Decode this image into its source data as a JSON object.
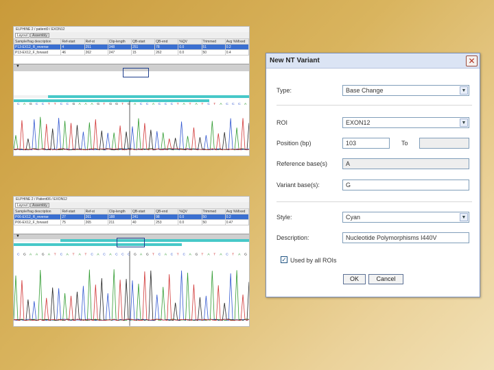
{
  "panels": {
    "top": {
      "title": "ELPHINE 2 / patient0 / EXON12",
      "tabs": [
        "Layout",
        "Assembly"
      ],
      "headers": [
        "Sample/frag description",
        "Ref-start",
        "Ref-st",
        "Clip-length",
        "QB-start",
        "QB-end",
        "%QV",
        "Trimmed",
        "Avg %Mixed",
        "Avg"
      ],
      "rows": [
        [
          "P13-EX12_R_reverse",
          "4",
          "251",
          "348",
          "251",
          "78",
          "0.0",
          "51",
          "0.2"
        ],
        [
          "P13-EX12_F_forward",
          "46",
          "262",
          "247",
          "15",
          "262",
          "0.0",
          "50",
          "0.4"
        ]
      ]
    },
    "bottom": {
      "title": "ELPHINE 2 / Patient06 / EXON12",
      "tabs": [
        "Layout",
        "Assembly"
      ],
      "headers": [
        "Sample/frag description",
        "Ref-start",
        "Ref-st",
        "Clip-length",
        "QB-start",
        "QB-end",
        "%QV",
        "Trimmed",
        "Avg %Mixed",
        "Avg"
      ],
      "rows": [
        [
          "P06-EX12_R_reverse",
          "27",
          "261",
          "188",
          "241",
          "98",
          "0.0",
          "50",
          "0.2"
        ],
        [
          "P06-EX12_F_forward",
          "75",
          "265",
          "211",
          "40",
          "253",
          "0.0",
          "50",
          "0.47"
        ]
      ]
    }
  },
  "dialog": {
    "title": "New NT Variant",
    "type": {
      "label": "Type:",
      "value": "Base Change"
    },
    "roi": {
      "label": "ROI",
      "value": "EXON12"
    },
    "position": {
      "label": "Position (bp)",
      "value": "103",
      "to_label": "To",
      "to_value": ""
    },
    "reference": {
      "label": "Reference base(s)",
      "value": "A"
    },
    "variant": {
      "label": "Variant base(s):",
      "value": "G"
    },
    "style": {
      "label": "Style:",
      "value": "Cyan"
    },
    "description": {
      "label": "Description:",
      "value": "Nucleotide Polymorphisms I440V"
    },
    "used_by_all": {
      "label": "Used by all ROIs",
      "checked": true
    },
    "ok_label": "OK",
    "cancel_label": "Cancel"
  },
  "colors": {
    "selection": "#3a6fd0",
    "coverage": "#47c8c8",
    "trace_a": "#2e9a2e",
    "trace_c": "#2f55d0",
    "trace_g": "#222222",
    "trace_t": "#d03232"
  }
}
